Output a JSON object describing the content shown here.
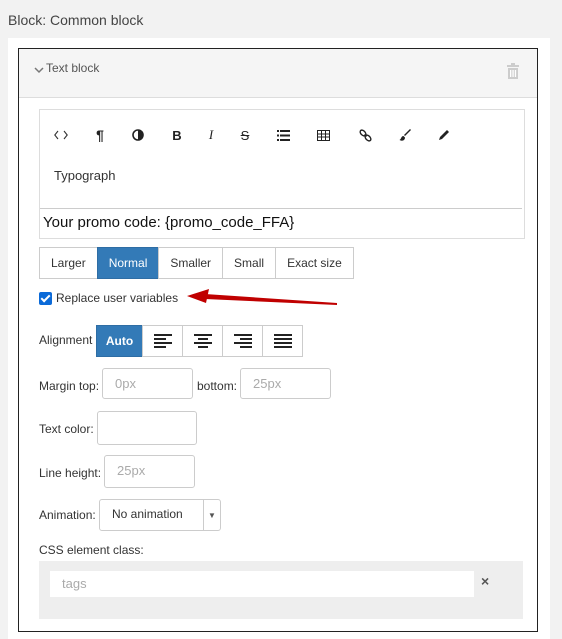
{
  "block_title": "Block: Common block",
  "panel": {
    "title": "Text block"
  },
  "toolbar": {
    "icons": [
      "code-icon",
      "paragraph-icon",
      "contrast-icon",
      "bold-icon",
      "italic-icon",
      "strikethrough-icon",
      "list-icon",
      "table-icon",
      "link-icon",
      "brush-icon",
      "pencil-icon"
    ],
    "labels": {
      "bold": "B",
      "italic": "I",
      "strike": "S",
      "paragraph": "¶"
    },
    "typograph": "Typograph"
  },
  "editor": {
    "content": "Your promo code: {promo_code_FFA}"
  },
  "size_buttons": [
    {
      "label": "Larger"
    },
    {
      "label": "Normal",
      "active": true
    },
    {
      "label": "Smaller"
    },
    {
      "label": "Small"
    },
    {
      "label": "Exact size"
    }
  ],
  "replace_vars": {
    "label": "Replace user variables",
    "checked": true
  },
  "alignment": {
    "label": "Alignment",
    "auto_label": "Auto",
    "options": [
      "left",
      "center",
      "right",
      "justify"
    ]
  },
  "margin": {
    "top_label": "Margin top:",
    "top_placeholder": "0px",
    "bottom_label": "bottom:",
    "bottom_placeholder": "25px"
  },
  "text_color": {
    "label": "Text color:"
  },
  "line_height": {
    "label": "Line height:",
    "placeholder": "25px"
  },
  "animation": {
    "label": "Animation:",
    "value": "No animation"
  },
  "css_class": {
    "label": "CSS element class:",
    "placeholder": "tags",
    "clear": "×"
  },
  "colors": {
    "accent": "#337ab7",
    "annotation_arrow": "#c00000"
  }
}
